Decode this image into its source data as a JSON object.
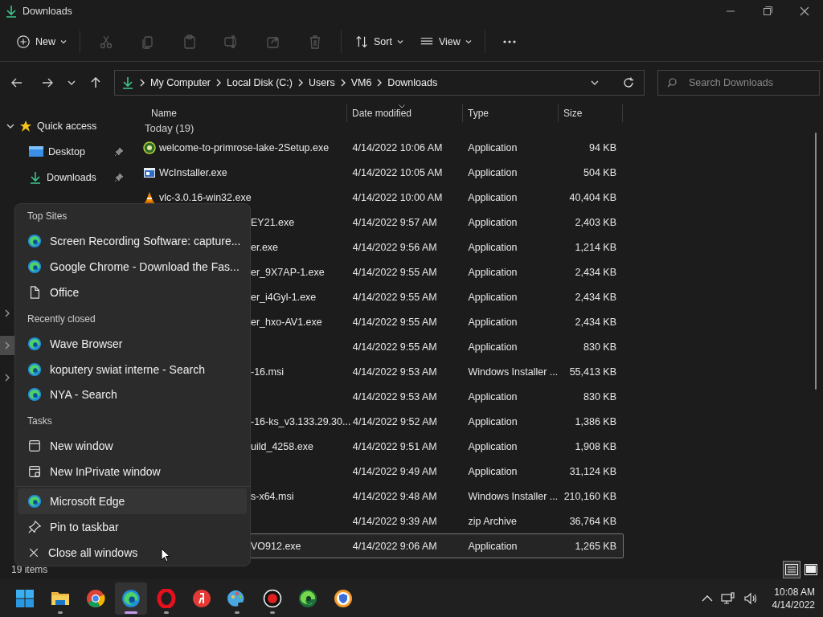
{
  "window": {
    "title": "Downloads"
  },
  "toolbar": {
    "new_label": "New",
    "actions": [
      {
        "kind": "cut",
        "disabled": true
      },
      {
        "kind": "copy",
        "disabled": true
      },
      {
        "kind": "paste",
        "disabled": true
      },
      {
        "kind": "rename",
        "disabled": true
      },
      {
        "kind": "share",
        "disabled": true
      },
      {
        "kind": "delete",
        "disabled": true
      }
    ],
    "sort_label": "Sort",
    "view_label": "View"
  },
  "address": {
    "segments": [
      "My Computer",
      "Local Disk (C:)",
      "Users",
      "VM6",
      "Downloads"
    ],
    "search_placeholder": "Search Downloads"
  },
  "sidebar": {
    "quick_access": {
      "label": "Quick access",
      "expanded": true
    },
    "items": [
      {
        "label": "Desktop",
        "kind": "desktop",
        "pinned": true
      },
      {
        "label": "Downloads",
        "kind": "download",
        "pinned": true
      }
    ],
    "collapsed_rows": [
      {
        "expanded": false,
        "selected": false
      },
      {
        "expanded": false,
        "selected": true
      },
      {
        "expanded": false,
        "selected": false
      }
    ]
  },
  "table": {
    "columns": [
      {
        "label": "Name",
        "sorted": false
      },
      {
        "label": "Date modified",
        "sorted": true
      },
      {
        "label": "Type",
        "sorted": false
      },
      {
        "label": "Size",
        "sorted": false
      }
    ],
    "group": "Today (19)",
    "rows": [
      {
        "name": "welcome-to-primrose-lake-2Setup.exe",
        "kind": "disc",
        "date": "4/14/2022 10:06 AM",
        "type": "Application",
        "size": "94 KB",
        "selected": false
      },
      {
        "name": "WcInstaller.exe",
        "kind": "window",
        "date": "4/14/2022 10:05 AM",
        "type": "Application",
        "size": "504 KB",
        "selected": false
      },
      {
        "name": "vlc-3.0.16-win32.exe",
        "kind": "cone",
        "date": "4/14/2022 10:00 AM",
        "type": "Application",
        "size": "40,404 KB",
        "selected": false
      },
      {
        "name": "EY21.exe",
        "date": "4/14/2022 9:57 AM",
        "type": "Application",
        "size": "2,403 KB",
        "selected": false
      },
      {
        "name": "er.exe",
        "date": "4/14/2022 9:56 AM",
        "type": "Application",
        "size": "1,214 KB",
        "selected": false
      },
      {
        "name": "er_9X7AP-1.exe",
        "date": "4/14/2022 9:55 AM",
        "type": "Application",
        "size": "2,434 KB",
        "selected": false
      },
      {
        "name": "er_i4Gyl-1.exe",
        "date": "4/14/2022 9:55 AM",
        "type": "Application",
        "size": "2,434 KB",
        "selected": false
      },
      {
        "name": "er_hxo-AV1.exe",
        "date": "4/14/2022 9:55 AM",
        "type": "Application",
        "size": "2,434 KB",
        "selected": false
      },
      {
        "date": "4/14/2022 9:55 AM",
        "type": "Application",
        "size": "830 KB",
        "selected": false
      },
      {
        "name": "-16.msi",
        "date": "4/14/2022 9:53 AM",
        "type": "Windows Installer ...",
        "size": "55,413 KB",
        "selected": false
      },
      {
        "date": "4/14/2022 9:53 AM",
        "type": "Application",
        "size": "830 KB",
        "selected": false
      },
      {
        "name": "-16-ks_v3.133.29.30...",
        "date": "4/14/2022 9:52 AM",
        "type": "Application",
        "size": "1,386 KB",
        "selected": false
      },
      {
        "name": "uild_4258.exe",
        "date": "4/14/2022 9:51 AM",
        "type": "Application",
        "size": "1,908 KB",
        "selected": false
      },
      {
        "date": "4/14/2022 9:49 AM",
        "type": "Application",
        "size": "31,124 KB",
        "selected": false
      },
      {
        "name": "s-x64.msi",
        "date": "4/14/2022 9:48 AM",
        "type": "Windows Installer ...",
        "size": "210,160 KB",
        "selected": false
      },
      {
        "date": "4/14/2022 9:39 AM",
        "type": "zip Archive",
        "size": "36,764 KB",
        "selected": false
      },
      {
        "name": "VO912.exe",
        "date": "4/14/2022 9:06 AM",
        "type": "Application",
        "size": "1,265 KB",
        "selected": true
      }
    ]
  },
  "status_bar": {
    "count": "19 items",
    "views": [
      {
        "kind": "details",
        "selected": true
      },
      {
        "kind": "tiles",
        "selected": false
      }
    ]
  },
  "jump_list": {
    "sections": [
      {
        "header": "Top Sites",
        "items": [
          {
            "label": "Screen Recording Software: capture...",
            "kind": "edge",
            "hovered": false
          },
          {
            "label": "Google Chrome - Download the Fas...",
            "kind": "edge",
            "hovered": false
          },
          {
            "label": "Office",
            "kind": "page",
            "hovered": false
          }
        ]
      },
      {
        "header": "Recently closed",
        "items": [
          {
            "label": "Wave Browser",
            "kind": "edge",
            "hovered": false
          },
          {
            "label": "koputery swiat interne - Search",
            "kind": "edge",
            "hovered": false
          },
          {
            "label": "NYA - Search",
            "kind": "edge",
            "hovered": false
          }
        ]
      },
      {
        "header": "Tasks",
        "items": [
          {
            "label": "New window",
            "kind": "window",
            "hovered": false
          },
          {
            "label": "New InPrivate window",
            "kind": "inprivate",
            "hovered": false
          }
        ]
      }
    ],
    "footer": [
      {
        "label": "Microsoft Edge",
        "kind": "edge",
        "hovered": true
      },
      {
        "label": "Pin to taskbar",
        "kind": "pin",
        "hovered": false
      },
      {
        "label": "Close all windows",
        "kind": "close",
        "hovered": false
      }
    ]
  },
  "taskbar": {
    "apps": [
      {
        "kind": "start",
        "running": false,
        "active": false
      },
      {
        "kind": "folder",
        "running": true,
        "active": false
      },
      {
        "kind": "chrome",
        "running": false,
        "active": false
      },
      {
        "kind": "edge",
        "running": true,
        "active": true
      },
      {
        "kind": "opera",
        "running": true,
        "active": false
      },
      {
        "kind": "yandex",
        "running": false,
        "active": false
      },
      {
        "kind": "paint",
        "running": true,
        "active": false
      },
      {
        "kind": "record",
        "running": true,
        "active": false
      },
      {
        "kind": "edgedev",
        "running": false,
        "active": false
      },
      {
        "kind": "shield",
        "running": false,
        "active": false
      }
    ],
    "time": "10:08 AM",
    "date": "4/14/2022"
  }
}
